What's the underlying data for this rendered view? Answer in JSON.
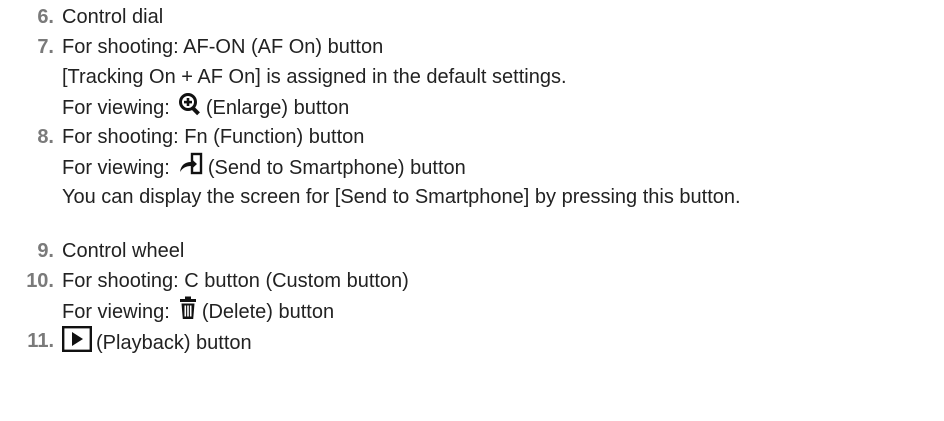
{
  "items": [
    {
      "num": "6.",
      "lines": [
        "Control dial"
      ]
    },
    {
      "num": "7.",
      "line1": "For shooting: AF-ON (AF On) button",
      "line2": "[Tracking On + AF On] is assigned in the default settings.",
      "line3_prefix": "For viewing:",
      "line3_icon": "enlarge-icon",
      "line3_suffix": "(Enlarge) button"
    },
    {
      "num": "8.",
      "line1": "For shooting: Fn (Function) button",
      "line2_prefix": "For viewing:",
      "line2_icon": "send-to-smartphone-icon",
      "line2_suffix": "(Send to Smartphone) button",
      "line3": "You can display the screen for [Send to Smartphone] by pressing this button."
    },
    {
      "num": "9.",
      "line1": "Control wheel"
    },
    {
      "num": "10.",
      "line1": "For shooting: C button (Custom button)",
      "line2_prefix": "For viewing:",
      "line2_icon": "delete-icon",
      "line2_suffix": "(Delete) button"
    },
    {
      "num": "11.",
      "line1_icon": "playback-icon",
      "line1_suffix": "(Playback) button"
    }
  ],
  "colors": {
    "number": "#7a7a7a",
    "text": "#222222"
  }
}
